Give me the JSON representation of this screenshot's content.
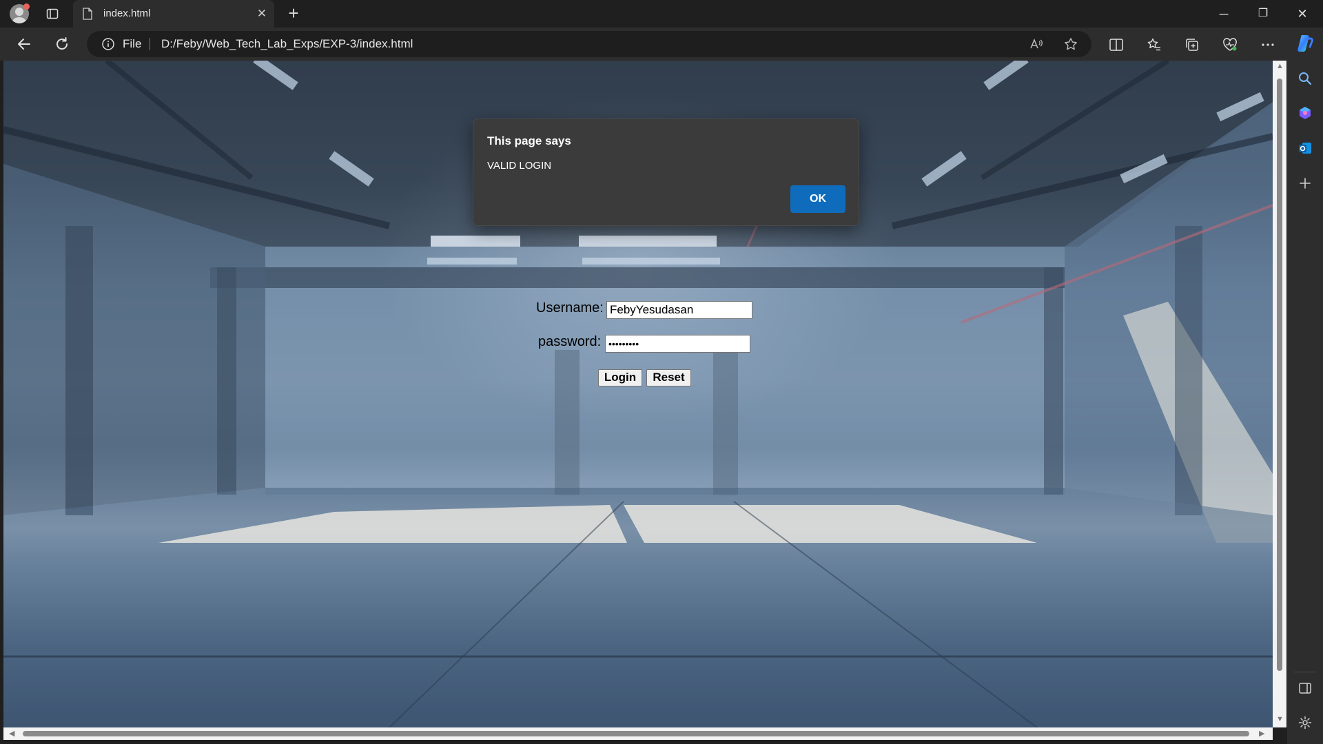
{
  "browser": {
    "tab_title": "index.html",
    "address_scheme_label": "File",
    "address_url": "D:/Feby/Web_Tech_Lab_Exps/EXP-3/index.html",
    "icons": [
      "profile-avatar",
      "tab-actions-icon",
      "file-icon",
      "close-icon",
      "plus-icon",
      "back-icon",
      "refresh-icon",
      "info-icon",
      "read-aloud-icon",
      "star-icon",
      "split-screen-icon",
      "favorites-icon",
      "collections-icon",
      "browser-essentials-icon",
      "more-icon",
      "copilot-icon",
      "search-icon",
      "outlook-icon",
      "sidebar-toggle-icon",
      "settings-icon"
    ],
    "window_controls": {
      "minimize": "─",
      "restore": "❐",
      "close": "✕"
    }
  },
  "form": {
    "username_label": "Username:",
    "username_value": "FebyYesudasan",
    "password_label": "password:",
    "password_value": "•••••••••",
    "login_label": "Login",
    "reset_label": "Reset"
  },
  "dialog": {
    "title": "This page says",
    "message": "VALID LOGIN",
    "ok_label": "OK"
  }
}
